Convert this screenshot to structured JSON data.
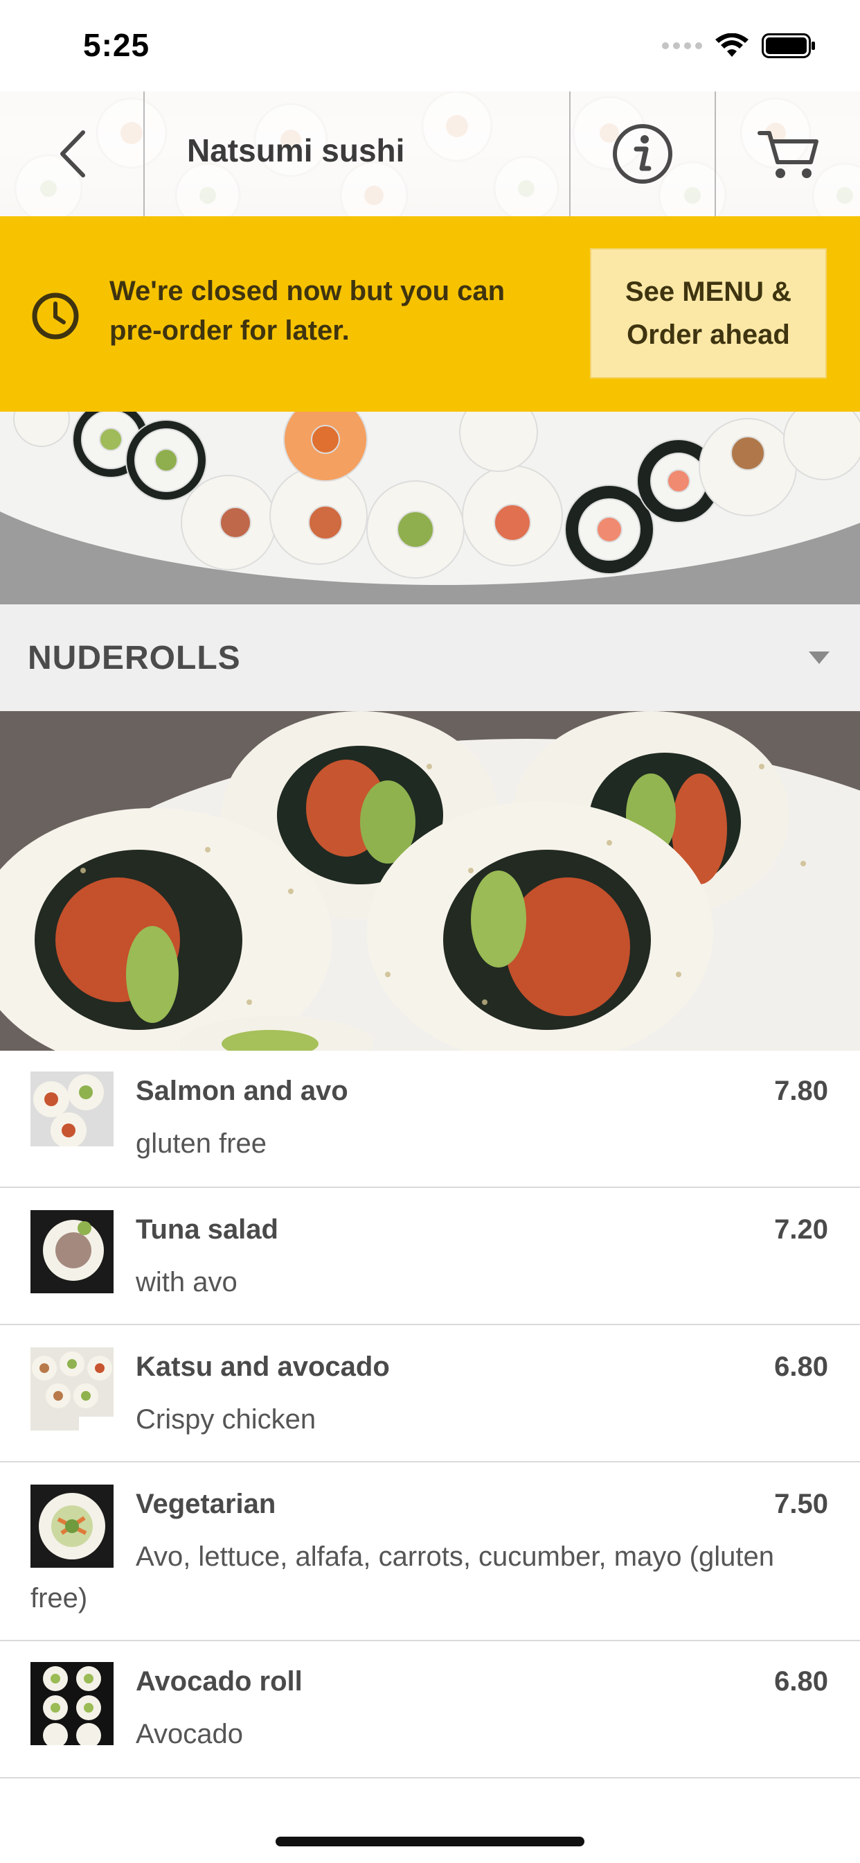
{
  "status_bar": {
    "time": "5:25"
  },
  "header": {
    "title": "Natsumi sushi"
  },
  "banner": {
    "message": "We're closed now but you can pre-order for later.",
    "button_line1": "See MENU &",
    "button_line2": "Order ahead"
  },
  "section": {
    "title": "NUDEROLLS"
  },
  "menu": {
    "items": [
      {
        "name": "Salmon and avo",
        "desc": "gluten free",
        "price": "7.80"
      },
      {
        "name": "Tuna salad",
        "desc": "with avo",
        "price": "7.20"
      },
      {
        "name": "Katsu and avocado",
        "desc": "Crispy chicken",
        "price": "6.80"
      },
      {
        "name": "Vegetarian",
        "desc": "Avo, lettuce, alfafa, carrots, cucumber, mayo (gluten free)",
        "price": "7.50"
      },
      {
        "name": "Avocado roll",
        "desc": "Avocado",
        "price": "6.80"
      }
    ]
  },
  "colors": {
    "banner": "#f7c300",
    "banner_button": "#fbe8a6",
    "text": "#4a4a4a",
    "section_bg": "#efefef"
  },
  "icons": [
    "back-chevron-icon",
    "info-icon",
    "cart-icon",
    "clock-icon",
    "caret-down-icon",
    "wifi-icon",
    "battery-icon"
  ]
}
